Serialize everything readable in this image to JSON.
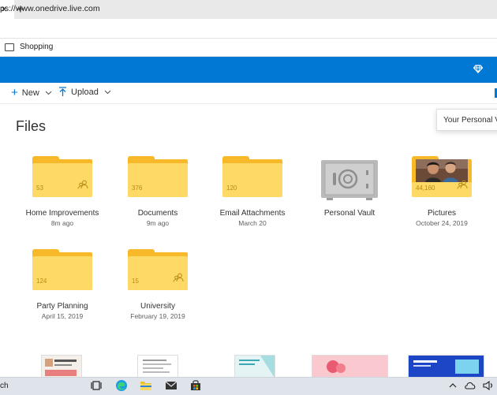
{
  "browser": {
    "tab_close": "×",
    "new_tab": "+",
    "url": "ps://www.onedrive.live.com",
    "bookmarks": [
      {
        "label": "Shopping"
      }
    ]
  },
  "commands": {
    "new_label": "New",
    "upload_label": "Upload"
  },
  "tooltip": {
    "text": "Your Personal Vau"
  },
  "page": {
    "title": "Files"
  },
  "folders": [
    {
      "name": "Home Improvements",
      "date": "8m ago",
      "count": "53",
      "shared": true
    },
    {
      "name": "Documents",
      "date": "9m ago",
      "count": "376",
      "shared": false
    },
    {
      "name": "Email Attachments",
      "date": "March 20",
      "count": "120",
      "shared": false
    },
    {
      "name": "Personal Vault",
      "date": "",
      "count": "",
      "shared": false
    },
    {
      "name": "Pictures",
      "date": "October 24, 2019",
      "count": "44,160",
      "shared": true
    },
    {
      "name": "Party Planning",
      "date": "April 15, 2019",
      "count": "124",
      "shared": false
    },
    {
      "name": "University",
      "date": "February 19, 2019",
      "count": "15",
      "shared": true
    }
  ],
  "taskbar": {
    "search_text": "ch"
  },
  "colors": {
    "onedrive_blue": "#0078d4",
    "folder_front": "#ffd966",
    "folder_back": "#f7b829"
  },
  "icons": [
    "close-icon",
    "plus-icon",
    "folder-icon",
    "diamond-icon",
    "chevron-down-icon",
    "upload-icon",
    "share-icon",
    "vault-icon",
    "task-view-icon",
    "edge-icon",
    "file-explorer-icon",
    "mail-icon",
    "store-icon",
    "chevron-up-icon",
    "cloud-icon",
    "speaker-icon"
  ]
}
